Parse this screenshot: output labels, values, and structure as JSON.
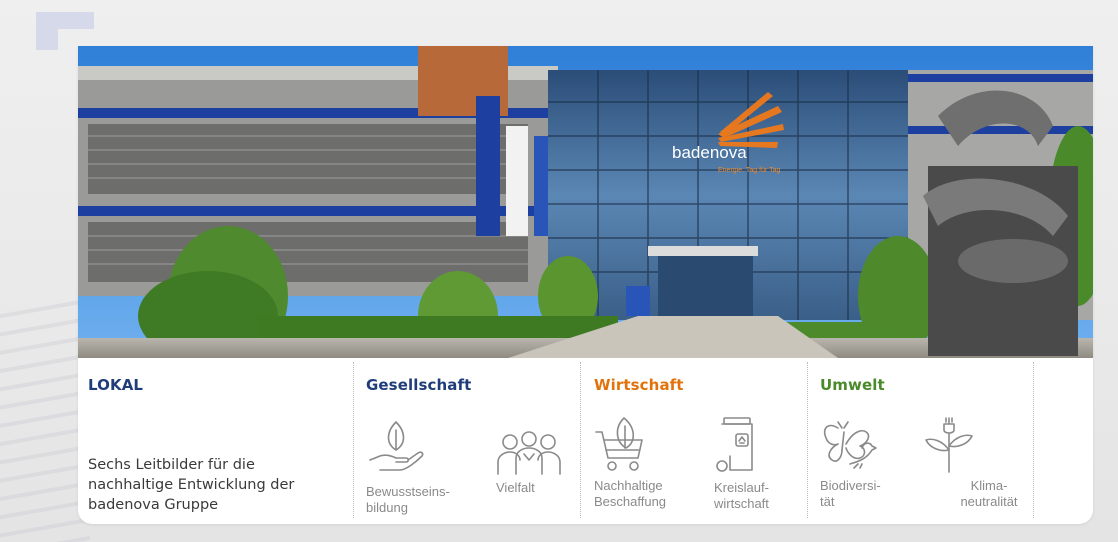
{
  "categories": {
    "lokal": "LOKAL",
    "gesellschaft": "Gesellschaft",
    "wirtschaft": "Wirtschaft",
    "umwelt": "Umwelt"
  },
  "tagline": "Sechs Leitbilder für die nachhaltige Entwicklung der badenova Gruppe",
  "photo": {
    "sign_brand": "badenova",
    "sign_slogan": "Energie. Tag für Tag"
  },
  "items": [
    {
      "label": "Bewusstseins-\nbildung",
      "icon": "hand-leaf-icon"
    },
    {
      "label": "Vielfalt",
      "icon": "people-group-icon"
    },
    {
      "label": "Nachhaltige\nBeschaffung",
      "icon": "cart-leaf-icon"
    },
    {
      "label": "Kreislauf-\nwirtschaft",
      "icon": "recycle-bin-icon"
    },
    {
      "label": "Biodiversi-\ntät",
      "icon": "butterfly-bird-icon"
    },
    {
      "label": "Klima-\nneutralität",
      "icon": "plant-plug-icon"
    }
  ],
  "colors": {
    "lokal": "#1f3d7a",
    "gesellschaft": "#1f3d7a",
    "wirtschaft": "#e2730c",
    "umwelt": "#4a8a2a",
    "icon_stroke": "#8a8a8a"
  }
}
